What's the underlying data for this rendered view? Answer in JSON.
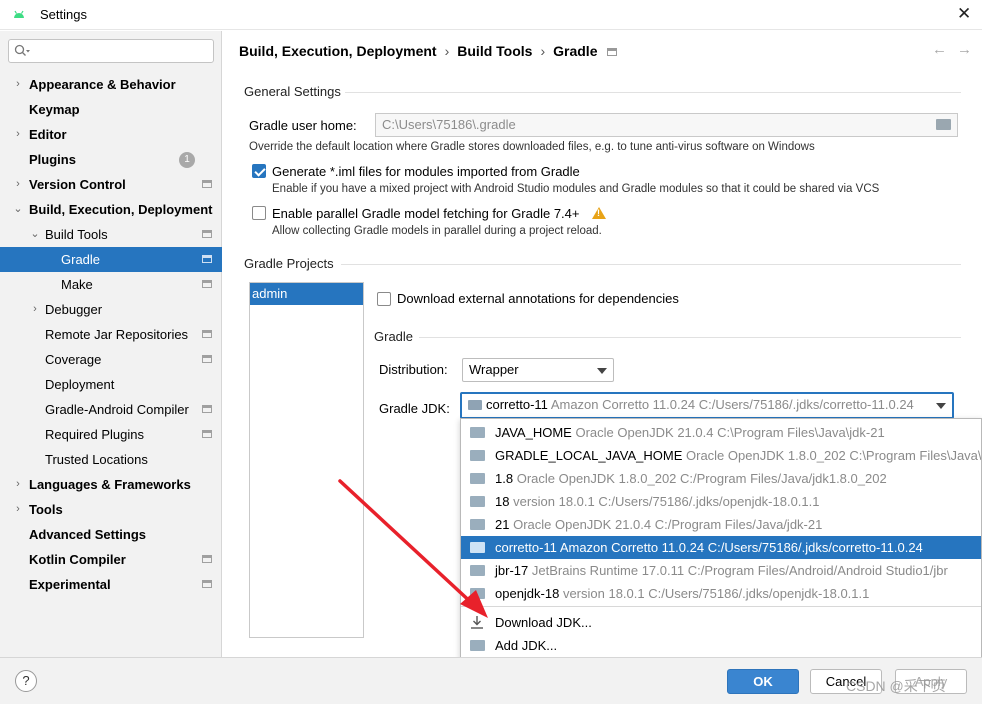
{
  "window": {
    "title": "Settings"
  },
  "sidebar": {
    "search_placeholder": "",
    "items": [
      {
        "label": "Appearance & Behavior"
      },
      {
        "label": "Keymap"
      },
      {
        "label": "Editor"
      },
      {
        "label": "Plugins",
        "badge": "1"
      },
      {
        "label": "Version Control"
      },
      {
        "label": "Build, Execution, Deployment"
      },
      {
        "label": "Build Tools"
      },
      {
        "label": "Gradle"
      },
      {
        "label": "Make"
      },
      {
        "label": "Debugger"
      },
      {
        "label": "Remote Jar Repositories"
      },
      {
        "label": "Coverage"
      },
      {
        "label": "Deployment"
      },
      {
        "label": "Gradle-Android Compiler"
      },
      {
        "label": "Required Plugins"
      },
      {
        "label": "Trusted Locations"
      },
      {
        "label": "Languages & Frameworks"
      },
      {
        "label": "Tools"
      },
      {
        "label": "Advanced Settings"
      },
      {
        "label": "Kotlin Compiler"
      },
      {
        "label": "Experimental"
      }
    ]
  },
  "breadcrumb": {
    "part1": "Build, Execution, Deployment",
    "part2": "Build Tools",
    "part3": "Gradle",
    "sep": "›"
  },
  "nav": {
    "back": "←",
    "forward": "→"
  },
  "general": {
    "title": "General Settings",
    "user_home_label": "Gradle user home:",
    "user_home_value": "C:\\Users\\75186\\.gradle",
    "user_home_hint": "Override the default location where Gradle stores downloaded files, e.g. to tune anti-virus software on Windows",
    "iml_label": "Generate *.iml files for modules imported from Gradle",
    "iml_hint": "Enable if you have a mixed project with Android Studio modules and Gradle modules so that it could be shared via VCS",
    "parallel_label": "Enable parallel Gradle model fetching for Gradle 7.4+",
    "parallel_hint": "Allow collecting Gradle models in parallel during a project reload."
  },
  "projects": {
    "title": "Gradle Projects",
    "list": [
      "admin"
    ],
    "annotations_label": "Download external annotations for dependencies",
    "gradle_title": "Gradle",
    "distribution_label": "Distribution:",
    "distribution_value": "Wrapper",
    "jdk_label": "Gradle JDK:",
    "jdk_value_name": "corretto-11",
    "jdk_value_detail": "Amazon Corretto 11.0.24 C:/Users/75186/.jdks/corretto-11.0.24"
  },
  "jdk_options": [
    {
      "name": "JAVA_HOME",
      "detail": "Oracle OpenJDK 21.0.4 C:\\Program Files\\Java\\jdk-21"
    },
    {
      "name": "GRADLE_LOCAL_JAVA_HOME",
      "detail": "Oracle OpenJDK 1.8.0_202 C:\\Program Files\\Java\\jdk1.8.0_202"
    },
    {
      "name": "1.8",
      "detail": "Oracle OpenJDK 1.8.0_202 C:/Program Files/Java/jdk1.8.0_202"
    },
    {
      "name": "18",
      "detail": "version 18.0.1 C:/Users/75186/.jdks/openjdk-18.0.1.1"
    },
    {
      "name": "21",
      "detail": "Oracle OpenJDK 21.0.4 C:/Program Files/Java/jdk-21"
    },
    {
      "name": "corretto-11",
      "detail": "Amazon Corretto 11.0.24 C:/Users/75186/.jdks/corretto-11.0.24"
    },
    {
      "name": "jbr-17",
      "detail": "JetBrains Runtime 17.0.11 C:/Program Files/Android/Android Studio1/jbr"
    },
    {
      "name": "openjdk-18",
      "detail": "version 18.0.1 C:/Users/75186/.jdks/openjdk-18.0.1.1"
    }
  ],
  "jdk_actions": {
    "download": "Download JDK...",
    "add": "Add JDK..."
  },
  "footer": {
    "help": "?",
    "ok": "OK",
    "cancel": "Cancel",
    "apply": "Apply"
  },
  "watermark": "CSDN @采下页",
  "colors": {
    "accent": "#2675bf",
    "arrow": "#e8212b"
  }
}
